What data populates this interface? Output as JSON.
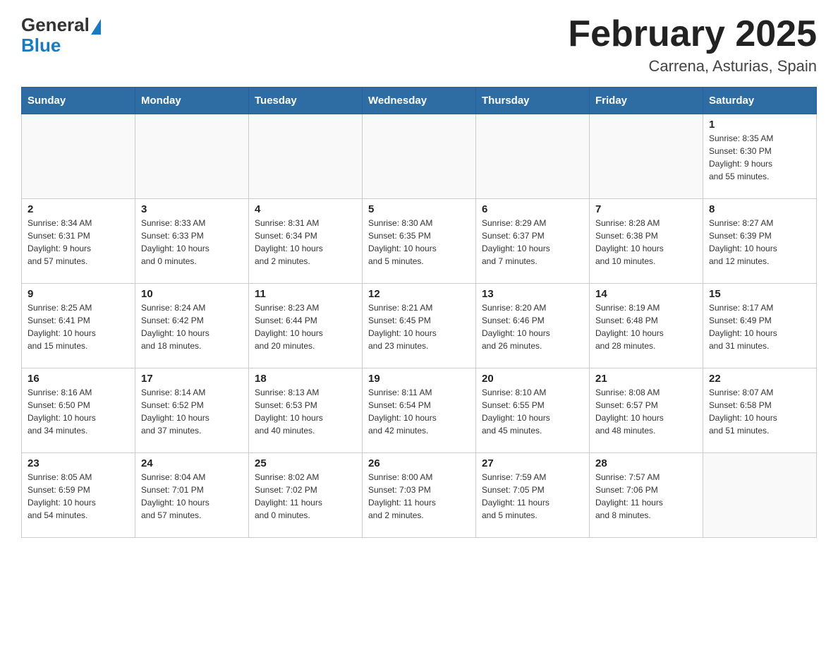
{
  "header": {
    "logo_general": "General",
    "logo_blue": "Blue",
    "title": "February 2025",
    "subtitle": "Carrena, Asturias, Spain"
  },
  "days_of_week": [
    "Sunday",
    "Monday",
    "Tuesday",
    "Wednesday",
    "Thursday",
    "Friday",
    "Saturday"
  ],
  "weeks": [
    [
      {
        "day": "",
        "info": ""
      },
      {
        "day": "",
        "info": ""
      },
      {
        "day": "",
        "info": ""
      },
      {
        "day": "",
        "info": ""
      },
      {
        "day": "",
        "info": ""
      },
      {
        "day": "",
        "info": ""
      },
      {
        "day": "1",
        "info": "Sunrise: 8:35 AM\nSunset: 6:30 PM\nDaylight: 9 hours\nand 55 minutes."
      }
    ],
    [
      {
        "day": "2",
        "info": "Sunrise: 8:34 AM\nSunset: 6:31 PM\nDaylight: 9 hours\nand 57 minutes."
      },
      {
        "day": "3",
        "info": "Sunrise: 8:33 AM\nSunset: 6:33 PM\nDaylight: 10 hours\nand 0 minutes."
      },
      {
        "day": "4",
        "info": "Sunrise: 8:31 AM\nSunset: 6:34 PM\nDaylight: 10 hours\nand 2 minutes."
      },
      {
        "day": "5",
        "info": "Sunrise: 8:30 AM\nSunset: 6:35 PM\nDaylight: 10 hours\nand 5 minutes."
      },
      {
        "day": "6",
        "info": "Sunrise: 8:29 AM\nSunset: 6:37 PM\nDaylight: 10 hours\nand 7 minutes."
      },
      {
        "day": "7",
        "info": "Sunrise: 8:28 AM\nSunset: 6:38 PM\nDaylight: 10 hours\nand 10 minutes."
      },
      {
        "day": "8",
        "info": "Sunrise: 8:27 AM\nSunset: 6:39 PM\nDaylight: 10 hours\nand 12 minutes."
      }
    ],
    [
      {
        "day": "9",
        "info": "Sunrise: 8:25 AM\nSunset: 6:41 PM\nDaylight: 10 hours\nand 15 minutes."
      },
      {
        "day": "10",
        "info": "Sunrise: 8:24 AM\nSunset: 6:42 PM\nDaylight: 10 hours\nand 18 minutes."
      },
      {
        "day": "11",
        "info": "Sunrise: 8:23 AM\nSunset: 6:44 PM\nDaylight: 10 hours\nand 20 minutes."
      },
      {
        "day": "12",
        "info": "Sunrise: 8:21 AM\nSunset: 6:45 PM\nDaylight: 10 hours\nand 23 minutes."
      },
      {
        "day": "13",
        "info": "Sunrise: 8:20 AM\nSunset: 6:46 PM\nDaylight: 10 hours\nand 26 minutes."
      },
      {
        "day": "14",
        "info": "Sunrise: 8:19 AM\nSunset: 6:48 PM\nDaylight: 10 hours\nand 28 minutes."
      },
      {
        "day": "15",
        "info": "Sunrise: 8:17 AM\nSunset: 6:49 PM\nDaylight: 10 hours\nand 31 minutes."
      }
    ],
    [
      {
        "day": "16",
        "info": "Sunrise: 8:16 AM\nSunset: 6:50 PM\nDaylight: 10 hours\nand 34 minutes."
      },
      {
        "day": "17",
        "info": "Sunrise: 8:14 AM\nSunset: 6:52 PM\nDaylight: 10 hours\nand 37 minutes."
      },
      {
        "day": "18",
        "info": "Sunrise: 8:13 AM\nSunset: 6:53 PM\nDaylight: 10 hours\nand 40 minutes."
      },
      {
        "day": "19",
        "info": "Sunrise: 8:11 AM\nSunset: 6:54 PM\nDaylight: 10 hours\nand 42 minutes."
      },
      {
        "day": "20",
        "info": "Sunrise: 8:10 AM\nSunset: 6:55 PM\nDaylight: 10 hours\nand 45 minutes."
      },
      {
        "day": "21",
        "info": "Sunrise: 8:08 AM\nSunset: 6:57 PM\nDaylight: 10 hours\nand 48 minutes."
      },
      {
        "day": "22",
        "info": "Sunrise: 8:07 AM\nSunset: 6:58 PM\nDaylight: 10 hours\nand 51 minutes."
      }
    ],
    [
      {
        "day": "23",
        "info": "Sunrise: 8:05 AM\nSunset: 6:59 PM\nDaylight: 10 hours\nand 54 minutes."
      },
      {
        "day": "24",
        "info": "Sunrise: 8:04 AM\nSunset: 7:01 PM\nDaylight: 10 hours\nand 57 minutes."
      },
      {
        "day": "25",
        "info": "Sunrise: 8:02 AM\nSunset: 7:02 PM\nDaylight: 11 hours\nand 0 minutes."
      },
      {
        "day": "26",
        "info": "Sunrise: 8:00 AM\nSunset: 7:03 PM\nDaylight: 11 hours\nand 2 minutes."
      },
      {
        "day": "27",
        "info": "Sunrise: 7:59 AM\nSunset: 7:05 PM\nDaylight: 11 hours\nand 5 minutes."
      },
      {
        "day": "28",
        "info": "Sunrise: 7:57 AM\nSunset: 7:06 PM\nDaylight: 11 hours\nand 8 minutes."
      },
      {
        "day": "",
        "info": ""
      }
    ]
  ]
}
